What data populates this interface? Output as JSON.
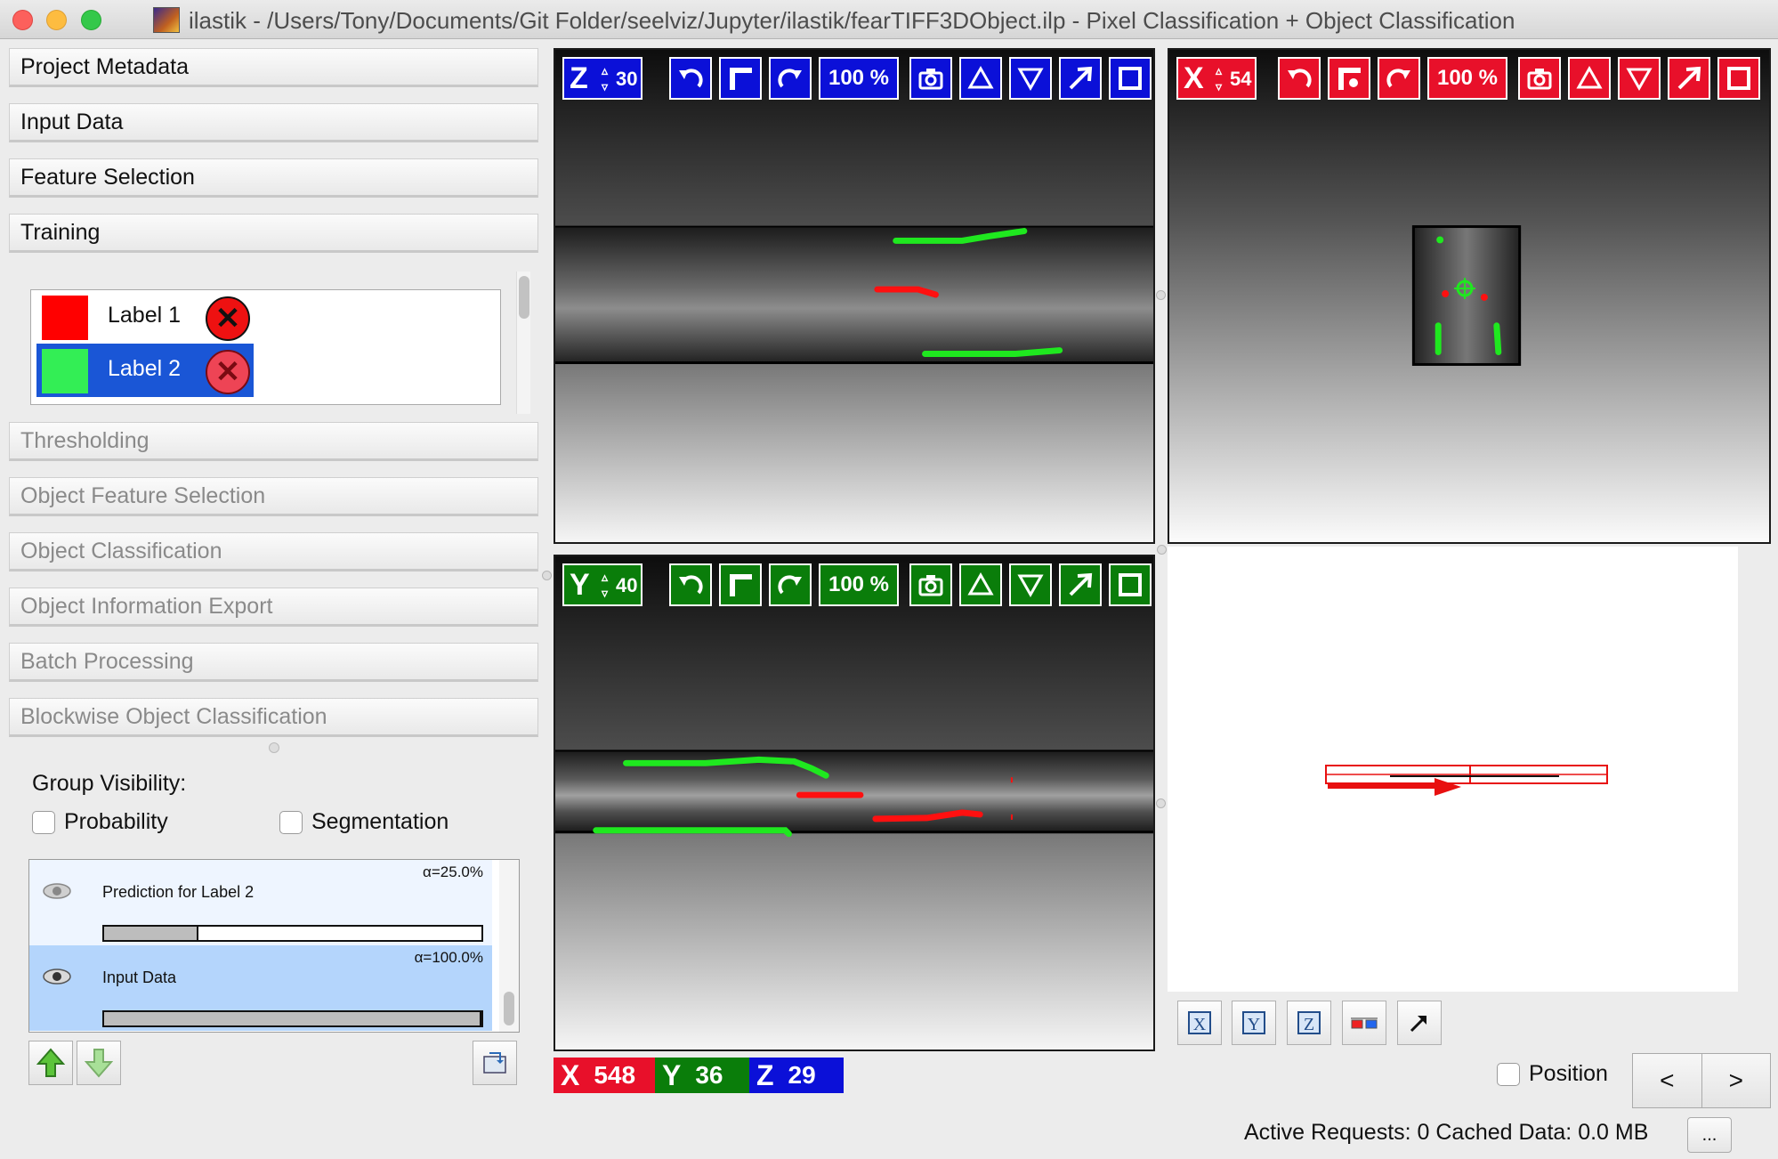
{
  "window": {
    "title": "ilastik - /Users/Tony/Documents/Git Folder/seelviz/Jupyter/ilastik/fearTIFF3DObject.ilp - Pixel Classification + Object Classification"
  },
  "applets": {
    "project_metadata": "Project Metadata",
    "input_data": "Input Data",
    "feature_selection": "Feature Selection",
    "training": "Training",
    "thresholding": "Thresholding",
    "object_feature_selection": "Object Feature Selection",
    "object_classification": "Object Classification",
    "object_information_export": "Object Information Export",
    "batch_processing": "Batch Processing",
    "blockwise_object_classification": "Blockwise Object Classification"
  },
  "labels": [
    {
      "name": "Label 1",
      "color": "#ff0000",
      "selected": false
    },
    {
      "name": "Label 2",
      "color": "#33ee55",
      "selected": true
    }
  ],
  "group_visibility": {
    "title": "Group Visibility:",
    "probability": "Probability",
    "segmentation": "Segmentation"
  },
  "layers": [
    {
      "name": "Prediction for Label 2",
      "alpha": "α=25.0%",
      "opacity": 0.25,
      "selected": false
    },
    {
      "name": "Input Data",
      "alpha": "α=100.0%",
      "opacity": 1.0,
      "selected": true
    }
  ],
  "viewers": {
    "z": {
      "axis": "Z",
      "slice": "30",
      "zoom": "100 %",
      "color": "#0b10d8"
    },
    "x": {
      "axis": "X",
      "slice": "54",
      "zoom": "100 %",
      "color": "#e8102a"
    },
    "y": {
      "axis": "Y",
      "slice": "40",
      "zoom": "100 %",
      "color": "#0a7d0a"
    }
  },
  "coordinates": {
    "x_label": "X",
    "x": "548",
    "y_label": "Y",
    "y": "36",
    "z_label": "Z",
    "z": "29"
  },
  "position_label": "Position",
  "nav": {
    "prev": "<",
    "next": ">"
  },
  "status": "Active Requests: 0  Cached Data: 0.0 MB",
  "more_label": "...",
  "icons": {
    "undo": "undo-icon",
    "crop": "crop-icon",
    "redo": "redo-icon",
    "snapshot": "camera-icon",
    "up": "triangle-up-icon",
    "down": "triangle-down-icon",
    "maximize": "arrow-diagonal-icon",
    "square": "square-icon"
  }
}
